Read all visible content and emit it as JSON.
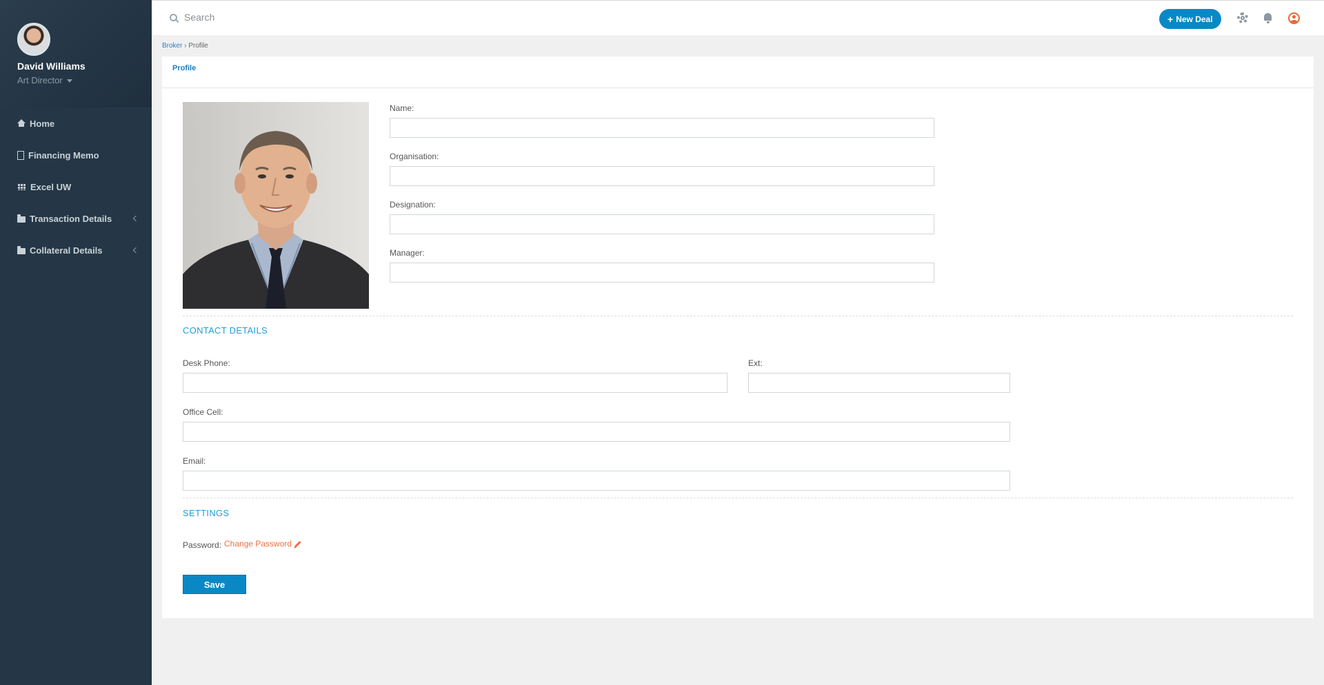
{
  "user": {
    "name": "David Williams",
    "role": "Art Director"
  },
  "sidebar": {
    "items": [
      {
        "label": "Home",
        "icon": "home-icon"
      },
      {
        "label": "Financing Memo",
        "icon": "document-icon"
      },
      {
        "label": "Excel UW",
        "icon": "grid-icon"
      },
      {
        "label": "Transaction Details",
        "icon": "folder-icon",
        "expandable": true
      },
      {
        "label": "Collateral Details",
        "icon": "folder-icon",
        "expandable": true
      }
    ]
  },
  "topbar": {
    "search_placeholder": "Search",
    "new_deal_label": "New Deal",
    "icons": [
      "search-icon",
      "plus-icon",
      "gear-icon",
      "bell-icon",
      "user-circle-icon"
    ]
  },
  "breadcrumb": {
    "parent": "Broker",
    "separator": "›",
    "current": "Profile"
  },
  "tabs": {
    "profile": "Profile"
  },
  "profile_fields": {
    "name_label": "Name:",
    "name_value": "",
    "organisation_label": "Organisation:",
    "organisation_value": "",
    "designation_label": "Designation:",
    "designation_value": "",
    "manager_label": "Manager:",
    "manager_value": ""
  },
  "contact": {
    "title": "CONTACT DETAILS",
    "desk_phone_label": "Desk Phone:",
    "desk_phone_value": "",
    "ext_label": "Ext:",
    "ext_value": "",
    "office_cell_label": "Office Cell:",
    "office_cell_value": "",
    "email_label": "Email:",
    "email_value": ""
  },
  "settings": {
    "title": "SETTINGS",
    "password_label": "Password:",
    "change_password_label": "Change Password"
  },
  "actions": {
    "save_label": "Save"
  },
  "colors": {
    "sidebar_bg": "#253746",
    "primary": "#0a88c6",
    "section_title": "#1ea0d6",
    "link_orange": "#ef6f42",
    "page_bg": "#f0f0f0"
  }
}
